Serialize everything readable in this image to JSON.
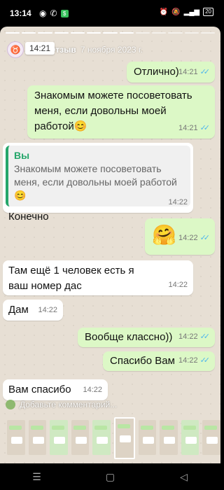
{
  "status_bar": {
    "time": "13:14",
    "battery": "20"
  },
  "story": {
    "user": "Отзыв",
    "date": "7 ноября 2023 г.",
    "tooltip": "14:21",
    "comment_placeholder": "Добавьте комментарий..."
  },
  "messages": [
    {
      "dir": "out",
      "text": "Отлично)",
      "time": "14:21",
      "read": true
    },
    {
      "dir": "out",
      "text": "Знакомым можете посоветовать меня, если довольны моей работой😊",
      "time": "14:21",
      "read": true
    },
    {
      "dir": "in",
      "quote_author": "Вы",
      "quote_text": "Знакомым можете посоветовать меня, если довольны моей работой😊",
      "text": "Конечно",
      "time": "14:22"
    },
    {
      "dir": "out",
      "text": "🤗",
      "time": "14:22",
      "read": true
    },
    {
      "dir": "in",
      "text": "Там ещё 1 человек есть я ваш номер дас",
      "time": "14:22"
    },
    {
      "dir": "in",
      "text": "Дам",
      "time": "14:22"
    },
    {
      "dir": "out",
      "text": "Вообще классно))",
      "time": "14:22",
      "read": true
    },
    {
      "dir": "out",
      "text": "Спасибо Вам",
      "time": "14:22",
      "read": true
    },
    {
      "dir": "in",
      "text": "Вам спасибо",
      "time": "14:22"
    }
  ],
  "icons": {
    "read_ticks": "✓✓",
    "nav_menu": "☰",
    "nav_home": "▢",
    "nav_back": "◁"
  },
  "colors": {
    "outgoing_bubble": "#dcf8c6",
    "incoming_bubble": "#ffffff",
    "quote_accent": "#25a66a",
    "read_tick": "#4fb6ec"
  }
}
